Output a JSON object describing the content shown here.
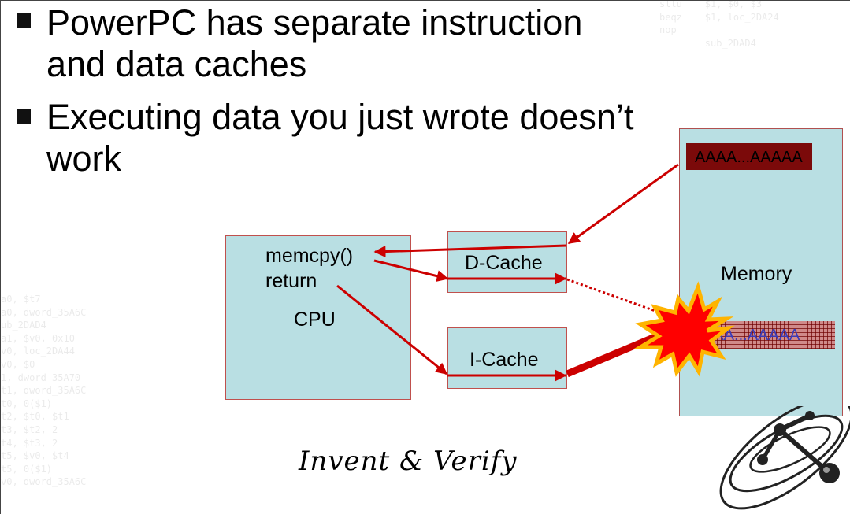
{
  "bullets": [
    {
      "text": "PowerPC has separate instruction and data caches"
    },
    {
      "text": "Executing data you just wrote doesn’t work"
    }
  ],
  "cpu": {
    "line1": "memcpy()",
    "line2": "return",
    "label": "CPU"
  },
  "dcache": {
    "label": "D-Cache"
  },
  "icache": {
    "label": "I-Cache"
  },
  "memory": {
    "label": "Memory",
    "top_data": "AAAA...AAAAA",
    "bottom_data": "AAA...AAAAA"
  },
  "signature": "Invent & Verify",
  "background_code": {
    "left": [
      "a0, $t7",
      "a0, dword_35A6C",
      "ub_2DAD4",
      "a1, $v0, 0x10",
      "v0, loc_2DA44",
      "v0, $0",
      "1, dword_35A70",
      "t1, dword_35A6C",
      "t0, 0($1)",
      "t2, $t0, $t1",
      "t3, $t2, 2",
      "t4, $t3, 2",
      "t5, $v0, $t4",
      "t5, 0($1)",
      "v0, dword_35A6C"
    ],
    "right": [
      "sltu    $1, $0, $3",
      "beqz    $1, loc_2DA24",
      "nop",
      "",
      "        sub_2DAD4"
    ]
  },
  "colors": {
    "box_fill": "#b9dfe3",
    "box_border": "#c0504d",
    "arrow": "#cc0000",
    "memory_block": "#7b0a0a",
    "explosion_fill": "#ff0000",
    "explosion_outline": "#ffb400"
  },
  "icons": {
    "explosion": "explosion-icon",
    "logo": "atom-logo-icon"
  }
}
